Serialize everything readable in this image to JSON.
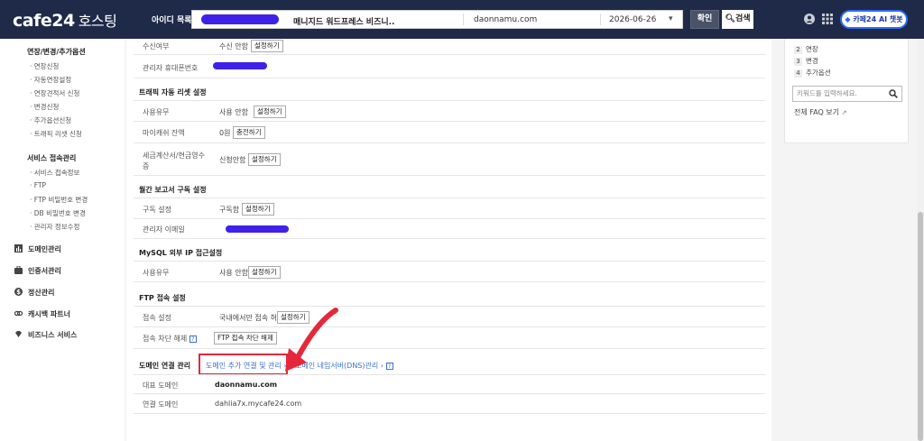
{
  "header": {
    "logo": "cafe24",
    "logo_sub": "호스팅",
    "account_label": "아이디 목록",
    "service_name": "매니지드 워드프레스 비즈니..",
    "domain": "daonnamu.com",
    "expire_date": "2026-06-26",
    "confirm_label": "확인",
    "search_label": "검색",
    "ai_chat_label": "카페24 AI 챗봇"
  },
  "sidebar": {
    "group1_title": "연장/변경/추가옵션",
    "group1_items": [
      "· 연장신청",
      "· 자동연장설정",
      "· 연장견적서 신청",
      "· 변경신청",
      "· 추가옵션신청",
      "· 트래픽 리셋 신청"
    ],
    "group2_title": "서비스 접속관리",
    "group2_items": [
      "· 서비스 접속정보",
      "· FTP",
      "· FTP 비밀번호 변경",
      "· DB 비밀번호 변경",
      "· 관리자 정보수정"
    ],
    "main_items": [
      "도메인관리",
      "인증서관리",
      "정산관리",
      "캐시백 파트너",
      "비즈니스 서비스"
    ]
  },
  "content": {
    "receive_label": "수신여부",
    "receive_value": "수신 안함",
    "admin_phone_label": "관리자 휴대폰번호",
    "traffic_title": "트래픽 자동 리셋 설정",
    "traffic_use_label": "사용유무",
    "traffic_use_value": "사용 안함",
    "mycash_label": "마이캐쉬 잔액",
    "mycash_value": "0원",
    "charge_label": "충전하기",
    "tax_label": "세금계산서/현금영수증",
    "tax_value": "신청안함",
    "monthly_title": "월간 보고서 구독 설정",
    "subscribe_label": "구독 설정",
    "subscribe_value": "구독함",
    "admin_email_label": "관리자 이메일",
    "mysql_title": "MySQL 외부 IP 접근설정",
    "mysql_use_label": "사용유무",
    "mysql_use_value": "사용 안함",
    "ftp_title": "FTP 접속 설정",
    "ftp_access_label": "접속 설정",
    "ftp_access_value": "국내에서만 접속 허용",
    "ftp_block_label": "접속 차단 해제",
    "ftp_block_button": "FTP 접속 차단 해제",
    "help_mark": "?",
    "set_button": "설정하기",
    "domain_mgmt_title": "도메인 연결 관리",
    "domain_add_link": "도메인 추가 연결 및 관리 ›",
    "dns_link": "도메인 네임서버(DNS)관리 ›",
    "main_domain_label": "대표 도메인",
    "main_domain_value": "daonnamu.com",
    "linked_domain_label": "연결 도메인",
    "linked_domain_value": "dahlia7x.mycafe24.com"
  },
  "right_panel": {
    "items": [
      {
        "num": "2",
        "label": "연장"
      },
      {
        "num": "3",
        "label": "변경"
      },
      {
        "num": "4",
        "label": "추가옵션"
      }
    ],
    "search_placeholder": "키워드를 입력하세요.",
    "faq_link": "전체 FAQ 보기"
  },
  "colors": {
    "topbar": "#1e2a48",
    "redaction": "#3f22e8",
    "highlight": "#e4283a",
    "link": "#3b6fd8"
  }
}
